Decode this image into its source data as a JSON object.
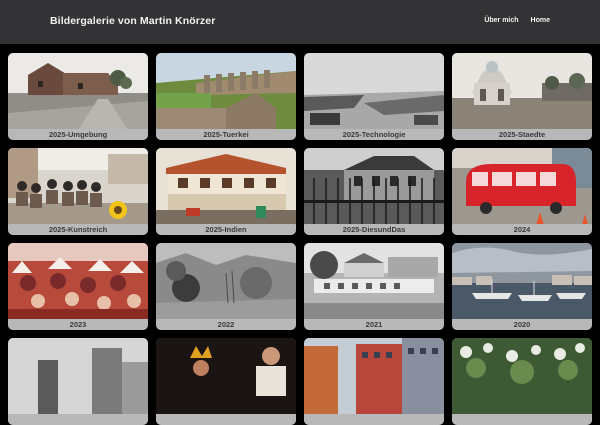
{
  "header": {
    "title": "Bildergalerie von Martin Knörzer",
    "nav": [
      "Über mich",
      "Home"
    ]
  },
  "gallery": {
    "items": [
      {
        "caption": "2025-Umgebung"
      },
      {
        "caption": "2025-Tuerkei"
      },
      {
        "caption": "2025-Technologie"
      },
      {
        "caption": "2025-Staedte"
      },
      {
        "caption": "2025-Kunstreich"
      },
      {
        "caption": "2025-Indien"
      },
      {
        "caption": "2025-DiesundDas"
      },
      {
        "caption": "2024"
      },
      {
        "caption": "2023"
      },
      {
        "caption": "2022"
      },
      {
        "caption": "2021"
      },
      {
        "caption": "2020"
      },
      {
        "caption": ""
      },
      {
        "caption": ""
      },
      {
        "caption": ""
      },
      {
        "caption": ""
      }
    ]
  },
  "colors": {
    "header_bg": "#333335",
    "page_bg": "#000000",
    "caption_bg": "#b8b8b8"
  }
}
